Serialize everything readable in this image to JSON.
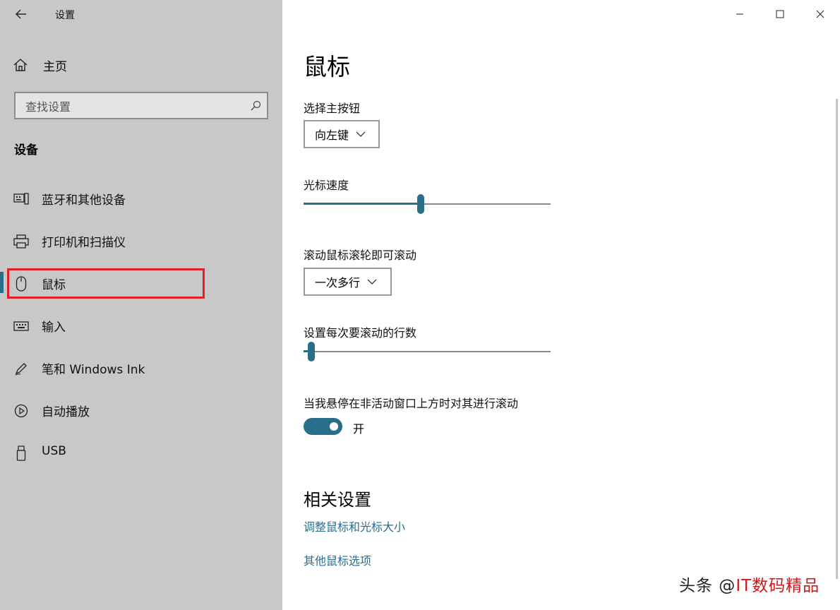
{
  "window": {
    "app_title": "设置",
    "controls": {
      "minimize": "minimize-icon",
      "maximize": "maximize-icon",
      "close": "close-icon"
    }
  },
  "sidebar": {
    "home_label": "主页",
    "search_placeholder": "查找设置",
    "section_title": "设备",
    "items": [
      {
        "label": "蓝牙和其他设备",
        "icon": "bluetooth-devices-icon"
      },
      {
        "label": "打印机和扫描仪",
        "icon": "printer-icon"
      },
      {
        "label": "鼠标",
        "icon": "mouse-icon",
        "active": true
      },
      {
        "label": "输入",
        "icon": "keyboard-icon"
      },
      {
        "label": "笔和 Windows Ink",
        "icon": "pen-icon"
      },
      {
        "label": "自动播放",
        "icon": "autoplay-icon"
      },
      {
        "label": "USB",
        "icon": "usb-icon"
      }
    ]
  },
  "main": {
    "title": "鼠标",
    "primary_button": {
      "label": "选择主按钮",
      "value": "向左键"
    },
    "cursor_speed": {
      "label": "光标速度",
      "level": 0.475
    },
    "scroll_wheel": {
      "label": "滚动鼠标滚轮即可滚动",
      "value": "一次多行"
    },
    "lines_to_scroll": {
      "label": "设置每次要滚动的行数",
      "level": 0.03
    },
    "inactive_scroll": {
      "label": "当我悬停在非活动窗口上方时对其进行滚动",
      "state": "开",
      "on": true
    },
    "related": {
      "title": "相关设置",
      "links": [
        "调整鼠标和光标大小",
        "其他鼠标选项"
      ]
    }
  },
  "watermark": {
    "left": "头条 @",
    "right": "IT数码精品"
  },
  "colors": {
    "accent": "#2a6f8a",
    "sidebar_bg": "#c8c8c8",
    "highlight": "#e1202a"
  }
}
